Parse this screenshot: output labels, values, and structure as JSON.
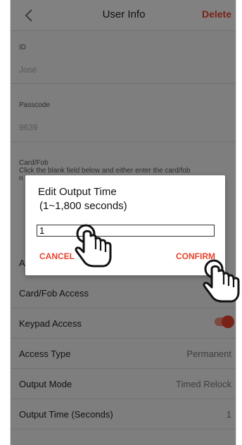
{
  "header": {
    "title": "User Info",
    "delete_label": "Delete"
  },
  "fields": {
    "id": {
      "label": "ID",
      "value": "José"
    },
    "passcode": {
      "label": "Passcode",
      "value": "9639"
    },
    "card": {
      "label": "Card/Fob",
      "hint_line1": "Click the blank field below and either enter the card/fob",
      "hint_line2": "n"
    }
  },
  "rows": {
    "partial_label": "A",
    "card_fob_access": "Card/Fob Access",
    "keypad_access": "Keypad Access",
    "access_type": {
      "label": "Access Type",
      "value": "Permanent"
    },
    "output_mode": {
      "label": "Output Mode",
      "value": "Timed Relock"
    },
    "output_time": {
      "label": "Output Time (Seconds)",
      "value": "1"
    }
  },
  "dialog": {
    "title": "Edit Output Time",
    "subtitle": "(1~1,800 seconds)",
    "input_value": "1",
    "cancel_label": "CANCEL",
    "confirm_label": "CONFIRM"
  },
  "toggles": {
    "keypad_access": true
  },
  "colors": {
    "accent": "#e8422c",
    "background": "#f2f2f2"
  },
  "icons": {
    "back": "chevron-left-icon",
    "tap": "tap-hand-icon"
  }
}
